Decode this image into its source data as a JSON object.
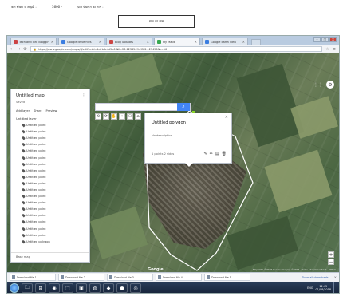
{
  "document": {
    "header_items": [
      "कम संख्या व आइडी :",
      "3600 -",
      "ग्राम पंचायत का नाम :"
    ],
    "box_label": "ग्राम का नाम"
  },
  "browser": {
    "tabs": [
      {
        "label": "Tech and Info Bloggin"
      },
      {
        "label": "Google drive files"
      },
      {
        "label": "Blog updates"
      },
      {
        "label": "My Maps",
        "active": true
      },
      {
        "label": "Google Earth view"
      }
    ],
    "url": "https://www.google.com/maps/d/edit?mid=1a2b3c4d5e6f&ll=26.123456%2C82.123456&z=16"
  },
  "map_ui": {
    "search_placeholder": "",
    "search_value": "",
    "tools": [
      "⟲",
      "⟳",
      "✋",
      "⌖",
      "⎔",
      "⌂"
    ],
    "gear": "⚙",
    "apps": "⋮⋮",
    "zoom_in": "+",
    "zoom_out": "−",
    "logo": "Google",
    "attribution": "Map data ©2018 Google Imagery ©2018 · Terms · Send feedback · 200 m"
  },
  "panel": {
    "title": "Untitled map",
    "subtitle": "Saved",
    "actions": [
      "Add layer",
      "Share",
      "Preview"
    ],
    "layer_head": "Untitled layer",
    "items": [
      "Untitled point",
      "Untitled point",
      "Untitled point",
      "Untitled point",
      "Untitled point",
      "Untitled point",
      "Untitled point",
      "Untitled point",
      "Untitled point",
      "Untitled point",
      "Untitled point",
      "Untitled point",
      "Untitled point",
      "Untitled point",
      "Untitled point",
      "Untitled point",
      "Untitled point",
      "Untitled point",
      "Untitled polygon"
    ],
    "base_map": "Base map",
    "more": "⋮"
  },
  "popup": {
    "title": "Untitled polygon",
    "description": "No description",
    "meta": "1 points 2 sides",
    "close": "×",
    "icons": [
      "✎",
      "✏",
      "▤",
      "🗑"
    ]
  },
  "downloads": {
    "items": [
      "Download file 1",
      "Download file 2",
      "Download file 3",
      "Download file 4",
      "Download file 5",
      "Download file 6"
    ],
    "show_all": "Show all downloads",
    "close": "×"
  },
  "taskbar": {
    "apps": [
      "🗀",
      "⊞",
      "◉",
      "⬚",
      "▣",
      "◍",
      "◆",
      "●",
      "◎"
    ],
    "time": "12:45",
    "date": "01/08/2018",
    "lang": "ENG"
  }
}
